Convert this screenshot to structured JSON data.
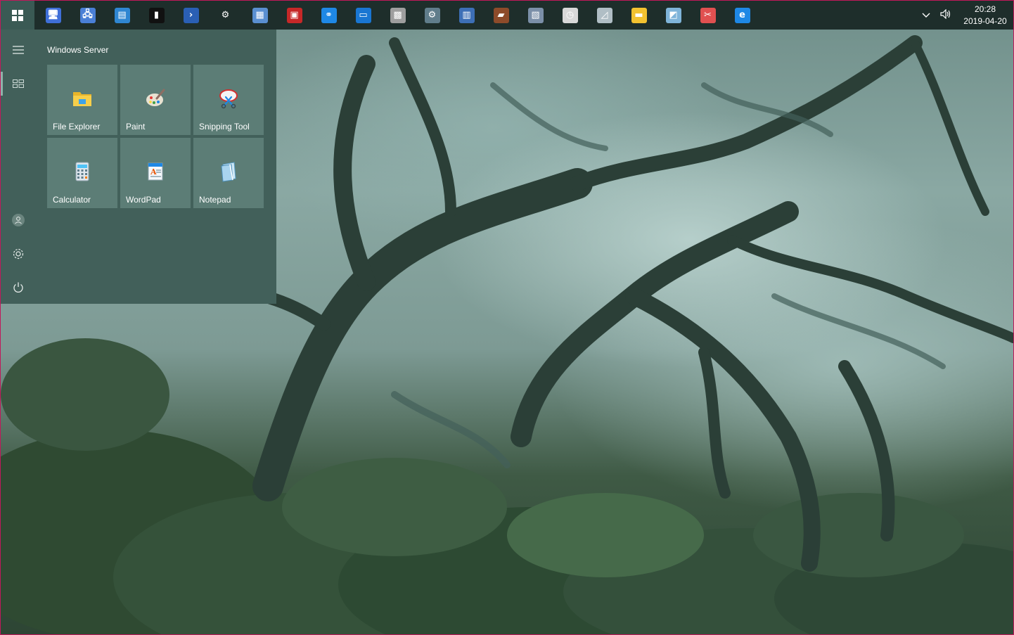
{
  "taskbar": {
    "pinned": [
      {
        "name": "computer-management-icon",
        "color": "#3f6fd8",
        "glyph": "🖥"
      },
      {
        "name": "remote-desktop-icon",
        "color": "#4a7fd6",
        "glyph": "🖧"
      },
      {
        "name": "server-manager-icon",
        "color": "#2f86d2",
        "glyph": "▤"
      },
      {
        "name": "command-prompt-icon",
        "color": "#111111",
        "glyph": "▮"
      },
      {
        "name": "powershell-icon",
        "color": "#2a5fb4",
        "glyph": "›"
      },
      {
        "name": "settings-icon",
        "color": "#1e2e2b",
        "glyph": "⚙"
      },
      {
        "name": "file-server-icon",
        "color": "#5a8fd0",
        "glyph": "▦"
      },
      {
        "name": "task-scheduler-icon",
        "color": "#c62828",
        "glyph": "▣"
      },
      {
        "name": "network-icon",
        "color": "#1e88e5",
        "glyph": "⚭"
      },
      {
        "name": "system-info-icon",
        "color": "#1976d2",
        "glyph": "▭"
      },
      {
        "name": "component-services-icon",
        "color": "#9e9e9e",
        "glyph": "▩"
      },
      {
        "name": "services-icon",
        "color": "#607d8b",
        "glyph": "⚙"
      },
      {
        "name": "device-manager-icon",
        "color": "#3d6fb6",
        "glyph": "▥"
      },
      {
        "name": "toolbox-icon",
        "color": "#8d4b2a",
        "glyph": "▰"
      },
      {
        "name": "event-viewer-icon",
        "color": "#7b8fa8",
        "glyph": "▧"
      },
      {
        "name": "clock-icon",
        "color": "#d8d8d8",
        "glyph": "◷"
      },
      {
        "name": "performance-monitor-icon",
        "color": "#b0bec5",
        "glyph": "◿"
      },
      {
        "name": "file-explorer-icon",
        "color": "#f2c230",
        "glyph": "▬"
      },
      {
        "name": "notepad-icon",
        "color": "#7fb4d9",
        "glyph": "◩"
      },
      {
        "name": "snipping-tool-icon",
        "color": "#e05050",
        "glyph": "✂"
      },
      {
        "name": "internet-explorer-icon",
        "color": "#1e88e5",
        "glyph": "e"
      }
    ],
    "time": "20:28",
    "date": "2019-04-20"
  },
  "start_menu": {
    "title": "Windows Server",
    "tiles": [
      {
        "label": "File Explorer",
        "icon": "file-explorer-icon"
      },
      {
        "label": "Paint",
        "icon": "paint-icon"
      },
      {
        "label": "Snipping Tool",
        "icon": "snipping-tool-icon"
      },
      {
        "label": "Calculator",
        "icon": "calculator-icon"
      },
      {
        "label": "WordPad",
        "icon": "wordpad-icon"
      },
      {
        "label": "Notepad",
        "icon": "notepad-icon"
      }
    ]
  }
}
